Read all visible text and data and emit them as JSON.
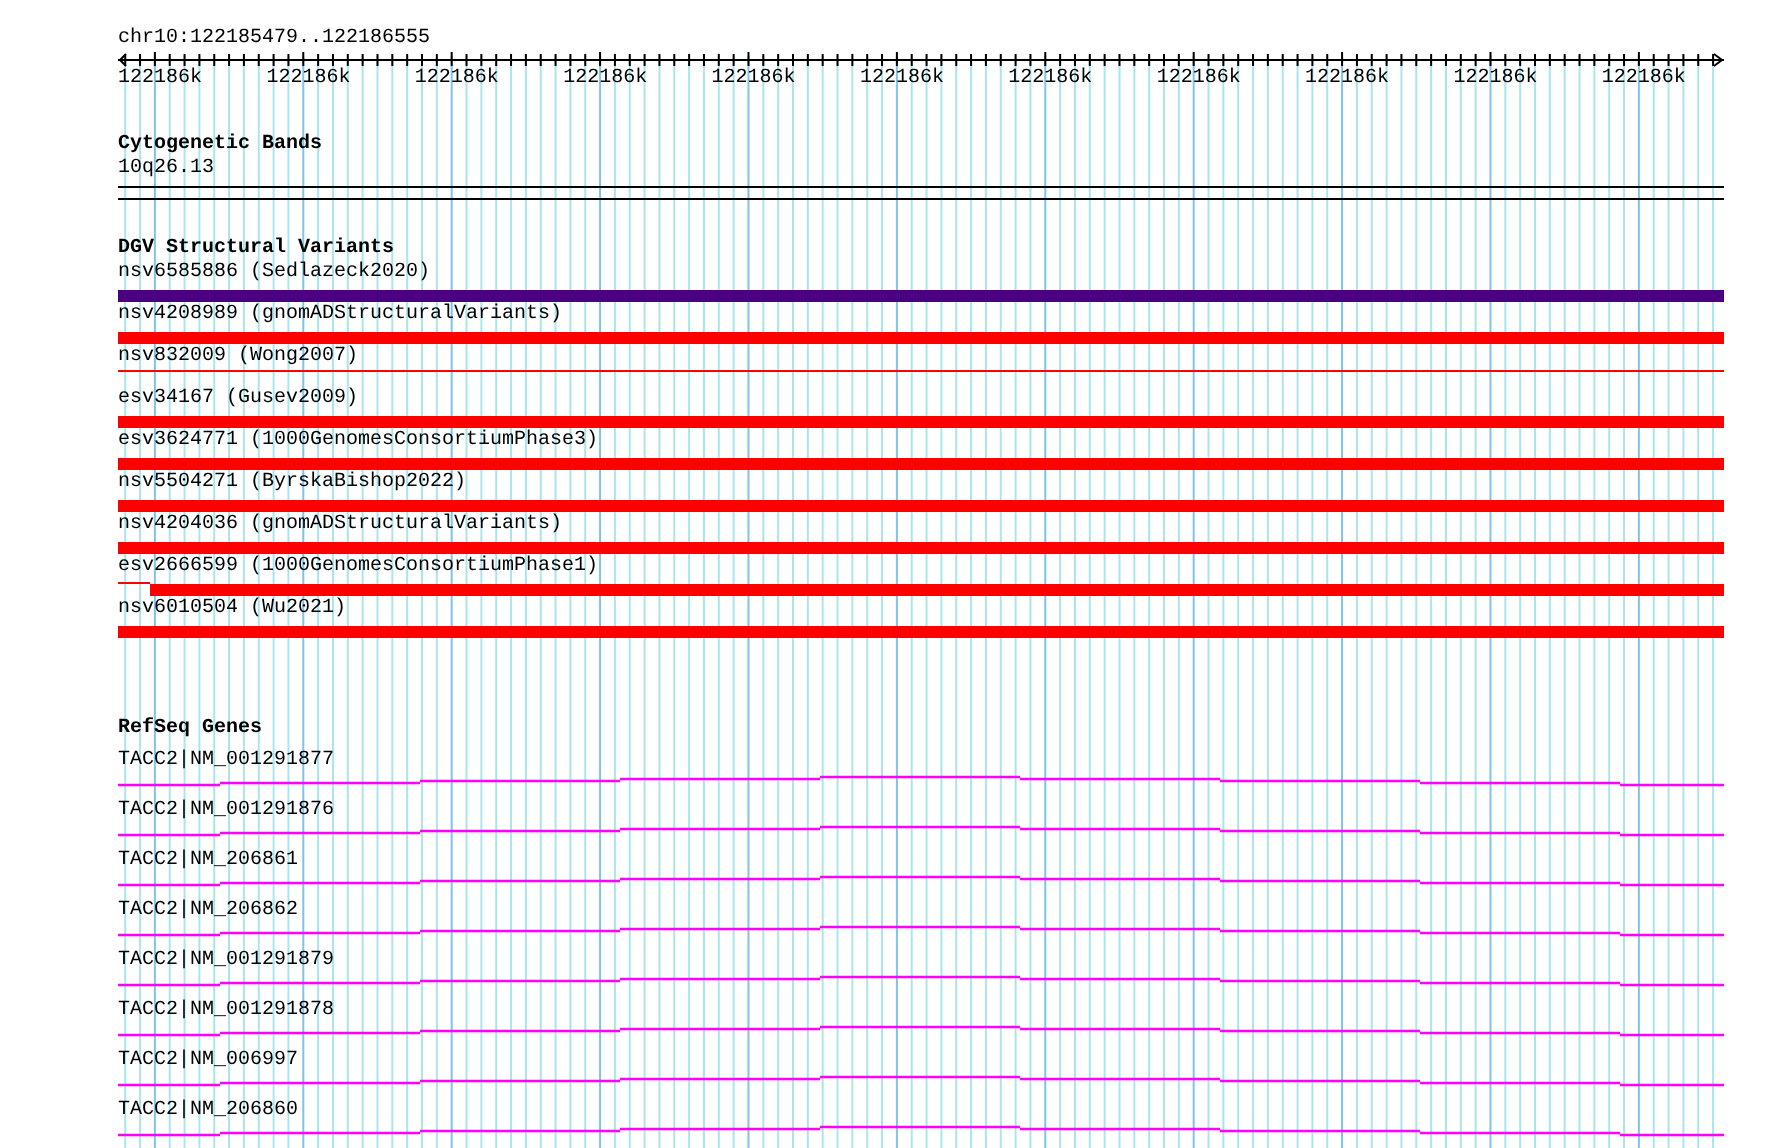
{
  "ruler": {
    "location": "chr10:122185479..122186555",
    "tick_labels": [
      "122186k",
      "122186k",
      "122186k",
      "122186k",
      "122186k",
      "122186k",
      "122186k",
      "122186k",
      "122186k",
      "122186k",
      "122186k"
    ]
  },
  "cytogenetic_bands": {
    "title": "Cytogenetic Bands",
    "band": "10q26.13"
  },
  "structural_variants": {
    "title": "DGV Structural Variants",
    "items": [
      {
        "label": "nsv6585886 (Sedlazeck2020)",
        "kind": "thick",
        "color": "#4b0082"
      },
      {
        "label": "nsv4208989 (gnomADStructuralVariants)",
        "kind": "thick",
        "color": "#ff0000"
      },
      {
        "label": "nsv832009 (Wong2007)",
        "kind": "thin",
        "color": "#ff0000"
      },
      {
        "label": "esv34167 (Gusev2009)",
        "kind": "thick",
        "color": "#ff0000"
      },
      {
        "label": "esv3624771 (1000GenomesConsortiumPhase3)",
        "kind": "thick",
        "color": "#ff0000"
      },
      {
        "label": "nsv5504271 (ByrskaBishop2022)",
        "kind": "thick",
        "color": "#ff0000"
      },
      {
        "label": "nsv4204036 (gnomADStructuralVariants)",
        "kind": "thick",
        "color": "#ff0000"
      },
      {
        "label": "esv2666599 (1000GenomesConsortiumPhase1)",
        "kind": "partial",
        "color": "#ff0000"
      },
      {
        "label": "nsv6010504 (Wu2021)",
        "kind": "thick",
        "color": "#ff0000"
      }
    ]
  },
  "refseq_genes": {
    "title": "RefSeq Genes",
    "items": [
      {
        "label": "TACC2|NM_001291877"
      },
      {
        "label": "TACC2|NM_001291876"
      },
      {
        "label": "TACC2|NM_206861"
      },
      {
        "label": "TACC2|NM_206862"
      },
      {
        "label": "TACC2|NM_001291879"
      },
      {
        "label": "TACC2|NM_001291878"
      },
      {
        "label": "TACC2|NM_006997"
      },
      {
        "label": "TACC2|NM_206860"
      }
    ]
  }
}
